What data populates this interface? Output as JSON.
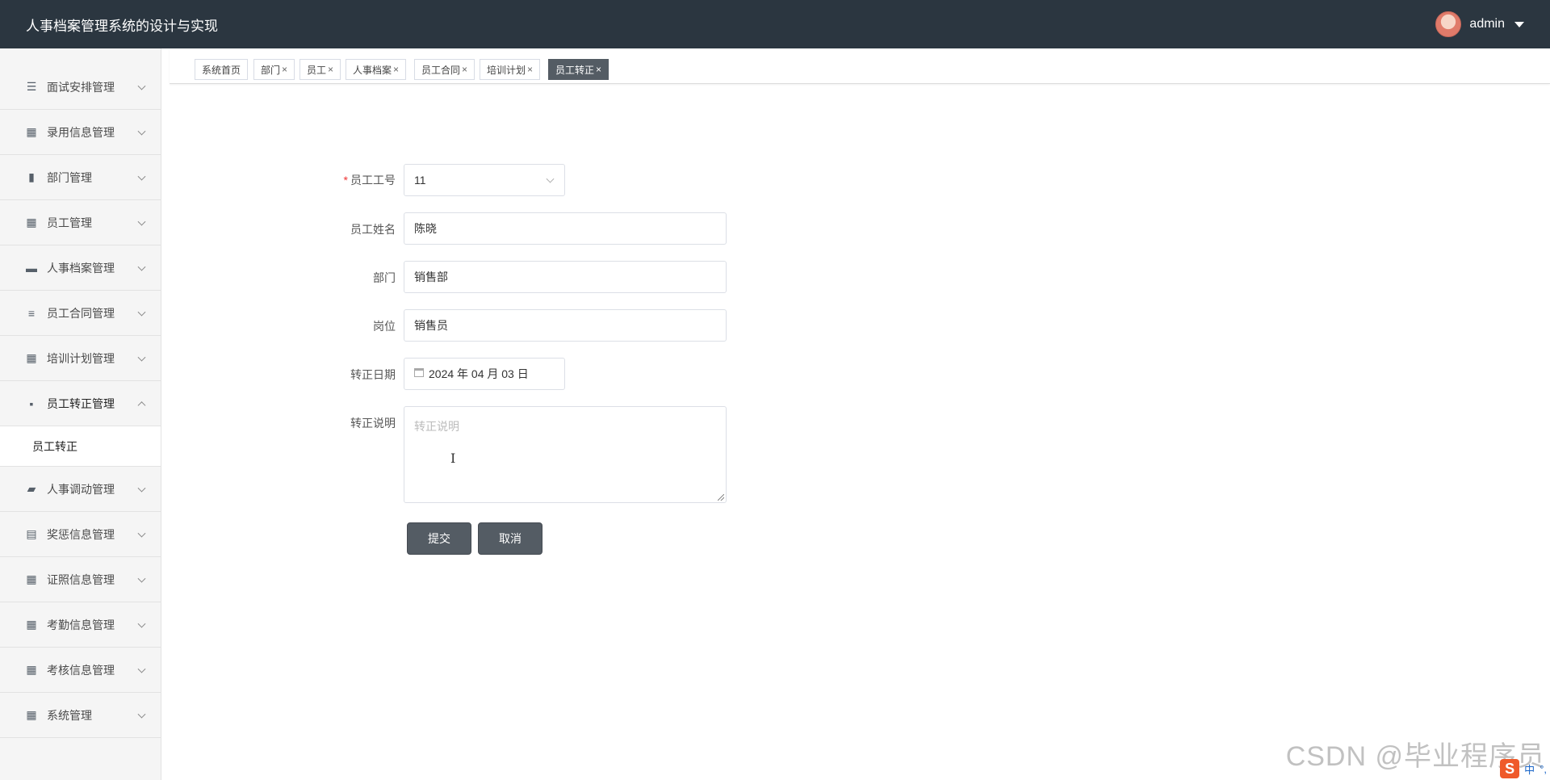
{
  "header": {
    "title": "人事档案管理系统的设计与实现",
    "username": "admin"
  },
  "sidebar": {
    "items": [
      {
        "label": "面试安排管理",
        "icon": "list-icon",
        "open": false
      },
      {
        "label": "录用信息管理",
        "icon": "grid-icon",
        "open": false
      },
      {
        "label": "部门管理",
        "icon": "book-icon",
        "open": false
      },
      {
        "label": "员工管理",
        "icon": "apps-icon",
        "open": false
      },
      {
        "label": "人事档案管理",
        "icon": "briefcase-icon",
        "open": false
      },
      {
        "label": "员工合同管理",
        "icon": "sliders-icon",
        "open": false
      },
      {
        "label": "培训计划管理",
        "icon": "grid-icon",
        "open": false
      },
      {
        "label": "员工转正管理",
        "icon": "message-icon",
        "open": true
      },
      {
        "label": "人事调动管理",
        "icon": "ticket-icon",
        "open": false
      },
      {
        "label": "奖惩信息管理",
        "icon": "clipboard-icon",
        "open": false
      },
      {
        "label": "证照信息管理",
        "icon": "grid-icon",
        "open": false
      },
      {
        "label": "考勤信息管理",
        "icon": "grid-icon",
        "open": false
      },
      {
        "label": "考核信息管理",
        "icon": "grid-icon",
        "open": false
      },
      {
        "label": "系统管理",
        "icon": "grid-icon",
        "open": false
      }
    ],
    "submenu": {
      "label": "员工转正"
    }
  },
  "tabs": [
    {
      "label": "系统首页",
      "closable": false,
      "active": false
    },
    {
      "label": "部门",
      "closable": true,
      "active": false
    },
    {
      "label": "员工",
      "closable": true,
      "active": false
    },
    {
      "label": "人事档案",
      "closable": true,
      "active": false
    },
    {
      "label": "员工合同",
      "closable": true,
      "active": false
    },
    {
      "label": "培训计划",
      "closable": true,
      "active": false
    },
    {
      "label": "员工转正",
      "closable": true,
      "active": true
    }
  ],
  "tab_close_glyph": "×",
  "form": {
    "employee_no": {
      "label": "员工工号",
      "value": "11"
    },
    "employee_name": {
      "label": "员工姓名",
      "value": "陈晓"
    },
    "department": {
      "label": "部门",
      "value": "销售部"
    },
    "position": {
      "label": "岗位",
      "value": "销售员"
    },
    "regular_date": {
      "label": "转正日期",
      "value": "2024 年 04 月 03 日"
    },
    "description": {
      "label": "转正说明",
      "placeholder": "转正说明",
      "value": ""
    },
    "required_mark": "*",
    "submit_label": "提交",
    "cancel_label": "取消"
  },
  "watermark": "CSDN @毕业程序员",
  "ime": {
    "logo": "S",
    "mode": "中",
    "punct": "°,"
  }
}
